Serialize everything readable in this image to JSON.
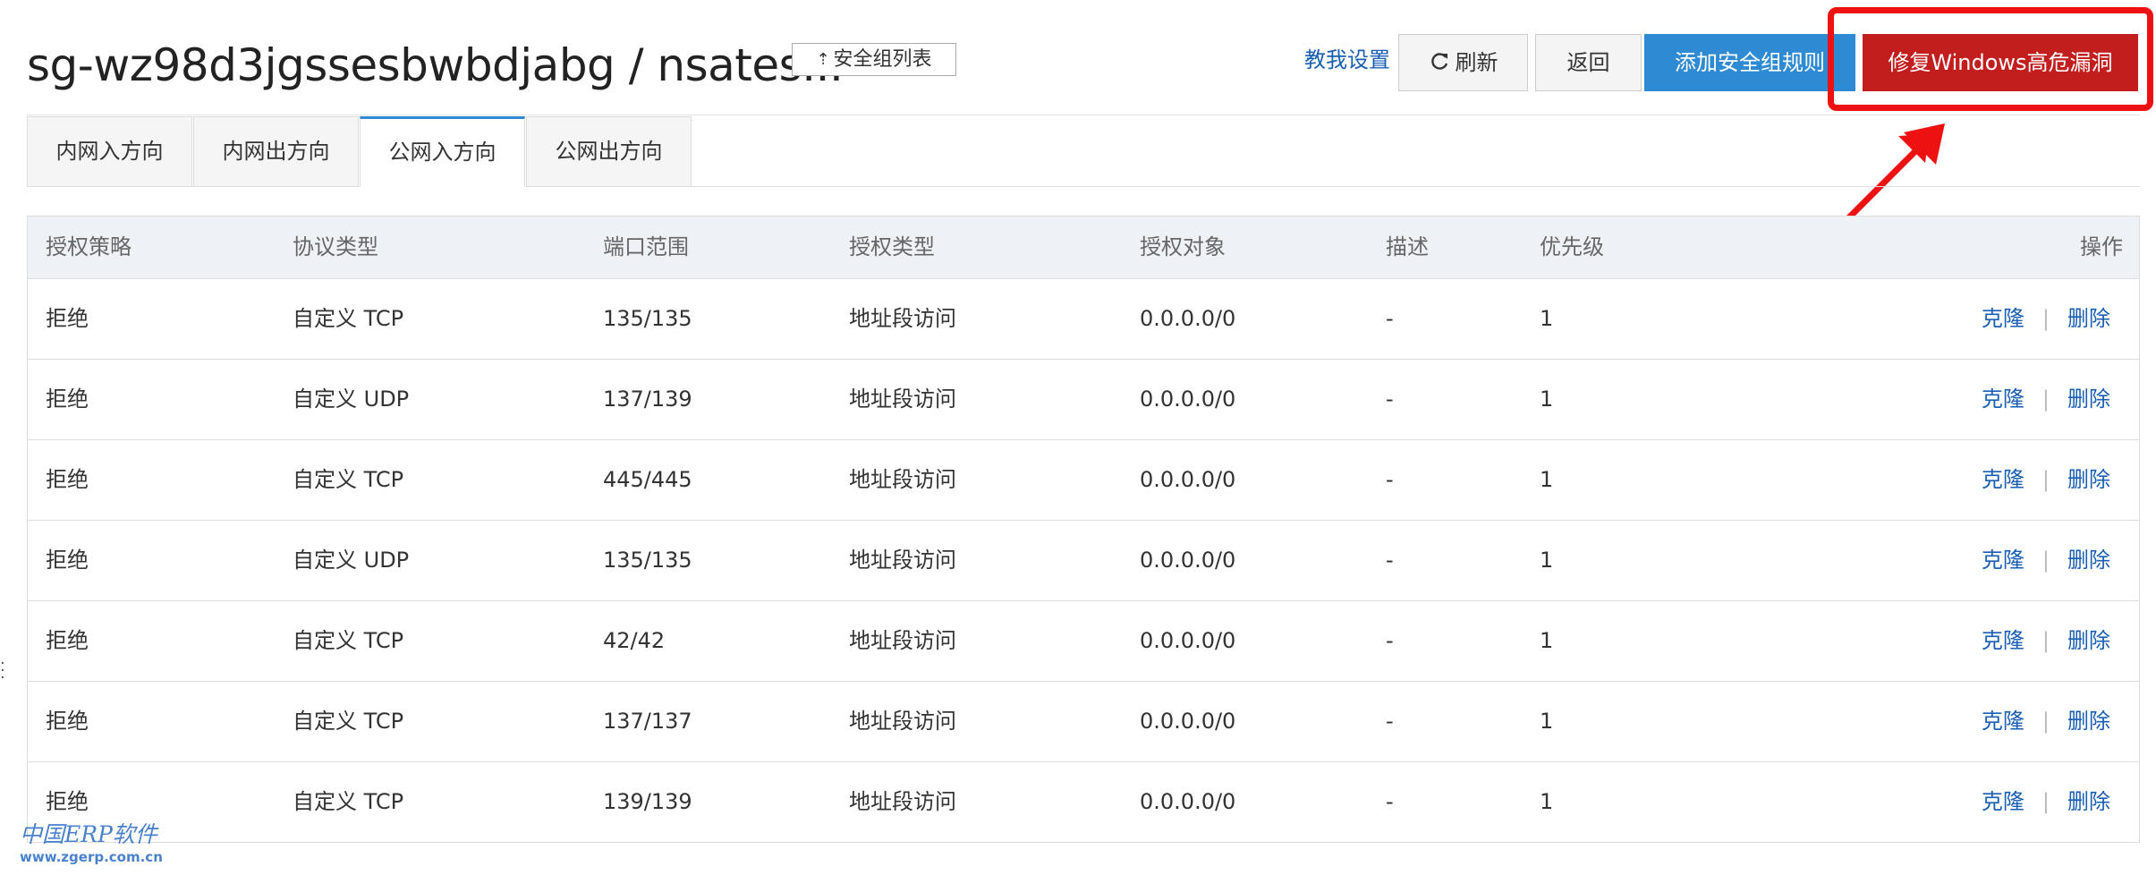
{
  "header": {
    "title": "sg-wz98d3jgssesbwbdjabg / nsates...",
    "sg_list_button": "安全组列表",
    "tutorial_link": "教我设置",
    "refresh_button": "刷新",
    "back_button": "返回",
    "add_rule_button": "添加安全组规则",
    "fix_button": "修复Windows高危漏洞"
  },
  "tabs": [
    {
      "label": "内网入方向",
      "active": false
    },
    {
      "label": "内网出方向",
      "active": false
    },
    {
      "label": "公网入方向",
      "active": true
    },
    {
      "label": "公网出方向",
      "active": false
    }
  ],
  "table": {
    "columns": [
      "授权策略",
      "协议类型",
      "端口范围",
      "授权类型",
      "授权对象",
      "描述",
      "优先级",
      "操作"
    ],
    "rows": [
      {
        "policy": "拒绝",
        "protocol": "自定义 TCP",
        "ports": "135/135",
        "auth_type": "地址段访问",
        "target": "0.0.0.0/0",
        "desc": "-",
        "priority": "1",
        "clone": "克隆",
        "delete": "删除"
      },
      {
        "policy": "拒绝",
        "protocol": "自定义 UDP",
        "ports": "137/139",
        "auth_type": "地址段访问",
        "target": "0.0.0.0/0",
        "desc": "-",
        "priority": "1",
        "clone": "克隆",
        "delete": "删除"
      },
      {
        "policy": "拒绝",
        "protocol": "自定义 TCP",
        "ports": "445/445",
        "auth_type": "地址段访问",
        "target": "0.0.0.0/0",
        "desc": "-",
        "priority": "1",
        "clone": "克隆",
        "delete": "删除"
      },
      {
        "policy": "拒绝",
        "protocol": "自定义 UDP",
        "ports": "135/135",
        "auth_type": "地址段访问",
        "target": "0.0.0.0/0",
        "desc": "-",
        "priority": "1",
        "clone": "克隆",
        "delete": "删除"
      },
      {
        "policy": "拒绝",
        "protocol": "自定义 TCP",
        "ports": "42/42",
        "auth_type": "地址段访问",
        "target": "0.0.0.0/0",
        "desc": "-",
        "priority": "1",
        "clone": "克隆",
        "delete": "删除"
      },
      {
        "policy": "拒绝",
        "protocol": "自定义 TCP",
        "ports": "137/137",
        "auth_type": "地址段访问",
        "target": "0.0.0.0/0",
        "desc": "-",
        "priority": "1",
        "clone": "克隆",
        "delete": "删除"
      },
      {
        "policy": "拒绝",
        "protocol": "自定义 TCP",
        "ports": "139/139",
        "auth_type": "地址段访问",
        "target": "0.0.0.0/0",
        "desc": "-",
        "priority": "1",
        "clone": "克隆",
        "delete": "删除"
      }
    ]
  },
  "watermark": {
    "line1": "中国ERP软件",
    "line2": "www.zgerp.com.cn"
  },
  "icons": {
    "sg_list": "upload-arrow-icon",
    "refresh": "refresh-icon",
    "annotation_arrow": "red-arrow-icon"
  },
  "colors": {
    "primary": "#2e8ad2",
    "danger": "#c21e1e",
    "link": "#1a5fb4",
    "annotation": "#ee1111"
  }
}
